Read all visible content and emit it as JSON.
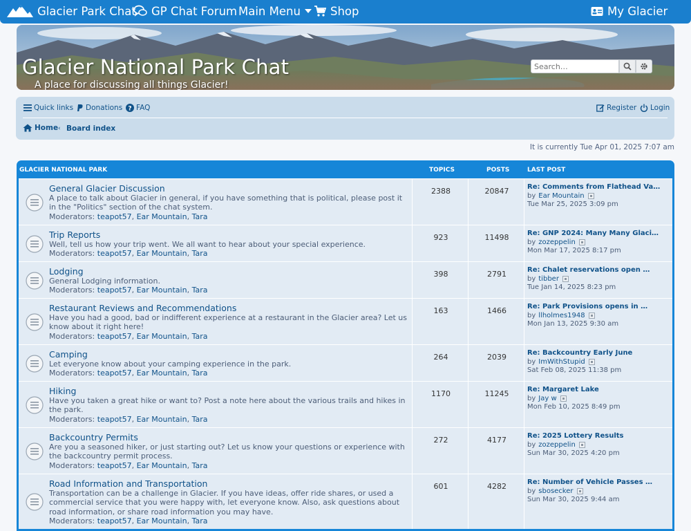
{
  "topnav": {
    "site_name": "Glacier Park Chat",
    "forum": "GP Chat Forum",
    "menu": "Main Menu",
    "shop": "Shop",
    "account": "My Glacier"
  },
  "banner": {
    "title": "Glacier National Park Chat",
    "subtitle": "A place for discussing all things Glacier!",
    "search_placeholder": "Search…"
  },
  "navbar": {
    "quick_links": "Quick links",
    "donations": "Donations",
    "faq": "FAQ",
    "register": "Register",
    "login": "Login",
    "breadcrumb_home": "Home",
    "breadcrumb_board": "Board index"
  },
  "status": {
    "currently": "It is currently Tue Apr 01, 2025 7:07 am"
  },
  "forum_table": {
    "section": "GLACIER NATIONAL PARK",
    "col_topics": "TOPICS",
    "col_posts": "POSTS",
    "col_last_post": "LAST POST",
    "moderators_label": "Moderators:",
    "by_label": "by",
    "rows": [
      {
        "name": "General Glacier Discussion",
        "desc": "A place to talk about Glacier in general, if you have something that is political, please post it in the \"Politics\" section of the chat system.",
        "mods": [
          "teapot57",
          "Ear Mountain",
          "Tara"
        ],
        "topics": "2388",
        "posts": "20847",
        "last_title": "Re: Comments from Flathead Va…",
        "last_user": "Ear Mountain",
        "last_date": "Tue Mar 25, 2025 3:09 pm"
      },
      {
        "name": "Trip Reports",
        "desc": "Well, tell us how your trip went. We all want to hear about your special experience.",
        "mods": [
          "teapot57",
          "Ear Mountain",
          "Tara"
        ],
        "topics": "923",
        "posts": "11498",
        "last_title": "Re: GNP 2024: Many Many Glaci…",
        "last_user": "zozeppelin",
        "last_date": "Mon Mar 17, 2025 8:17 pm"
      },
      {
        "name": "Lodging",
        "desc": "General Lodging information.",
        "mods": [
          "teapot57",
          "Ear Mountain",
          "Tara"
        ],
        "topics": "398",
        "posts": "2791",
        "last_title": "Re: Chalet reservations open …",
        "last_user": "tibber",
        "last_date": "Tue Jan 14, 2025 8:23 pm"
      },
      {
        "name": "Restaurant Reviews and Recommendations",
        "desc": "Have you had a good, bad or indifferent experience at a restaurant in the Glacier area? Let us know about it right here!",
        "mods": [
          "teapot57",
          "Ear Mountain",
          "Tara"
        ],
        "topics": "163",
        "posts": "1466",
        "last_title": "Re: Park Provisions opens in …",
        "last_user": "llholmes1948",
        "last_date": "Mon Jan 13, 2025 9:30 am"
      },
      {
        "name": "Camping",
        "desc": "Let everyone know about your camping experience in the park.",
        "mods": [
          "teapot57",
          "Ear Mountain",
          "Tara"
        ],
        "topics": "264",
        "posts": "2039",
        "last_title": "Re: Backcountry Early June",
        "last_user": "ImWithStupid",
        "last_date": "Sat Feb 08, 2025 11:38 pm"
      },
      {
        "name": "Hiking",
        "desc": "Have you taken a great hike or want to? Post a note here about the various trails and hikes in the park.",
        "mods": [
          "teapot57",
          "Ear Mountain",
          "Tara"
        ],
        "topics": "1170",
        "posts": "11245",
        "last_title": "Re: Margaret Lake",
        "last_user": "Jay w",
        "last_date": "Mon Feb 10, 2025 8:49 pm"
      },
      {
        "name": "Backcountry Permits",
        "desc": "Are you a seasoned hiker, or just starting out? Let us know your questions or experience with the backcountry permit process.",
        "mods": [
          "teapot57",
          "Ear Mountain",
          "Tara"
        ],
        "topics": "272",
        "posts": "4177",
        "last_title": "Re: 2025 Lottery Results",
        "last_user": "zozeppelin",
        "last_date": "Sun Mar 30, 2025 4:20 pm"
      },
      {
        "name": "Road Information and Transportation",
        "desc": "Transportation can be a challenge in Glacier. If you have ideas, offer ride shares, or used a commercial service that you were happy with, let everyone know. Also, ask questions about road information, or share road information you may have.",
        "mods": [
          "teapot57",
          "Ear Mountain",
          "Tara"
        ],
        "topics": "601",
        "posts": "4282",
        "last_title": "Re: Number of Vehicle Passes …",
        "last_user": "sbosecker",
        "last_date": "Sun Mar 30, 2025 9:44 am"
      }
    ]
  }
}
